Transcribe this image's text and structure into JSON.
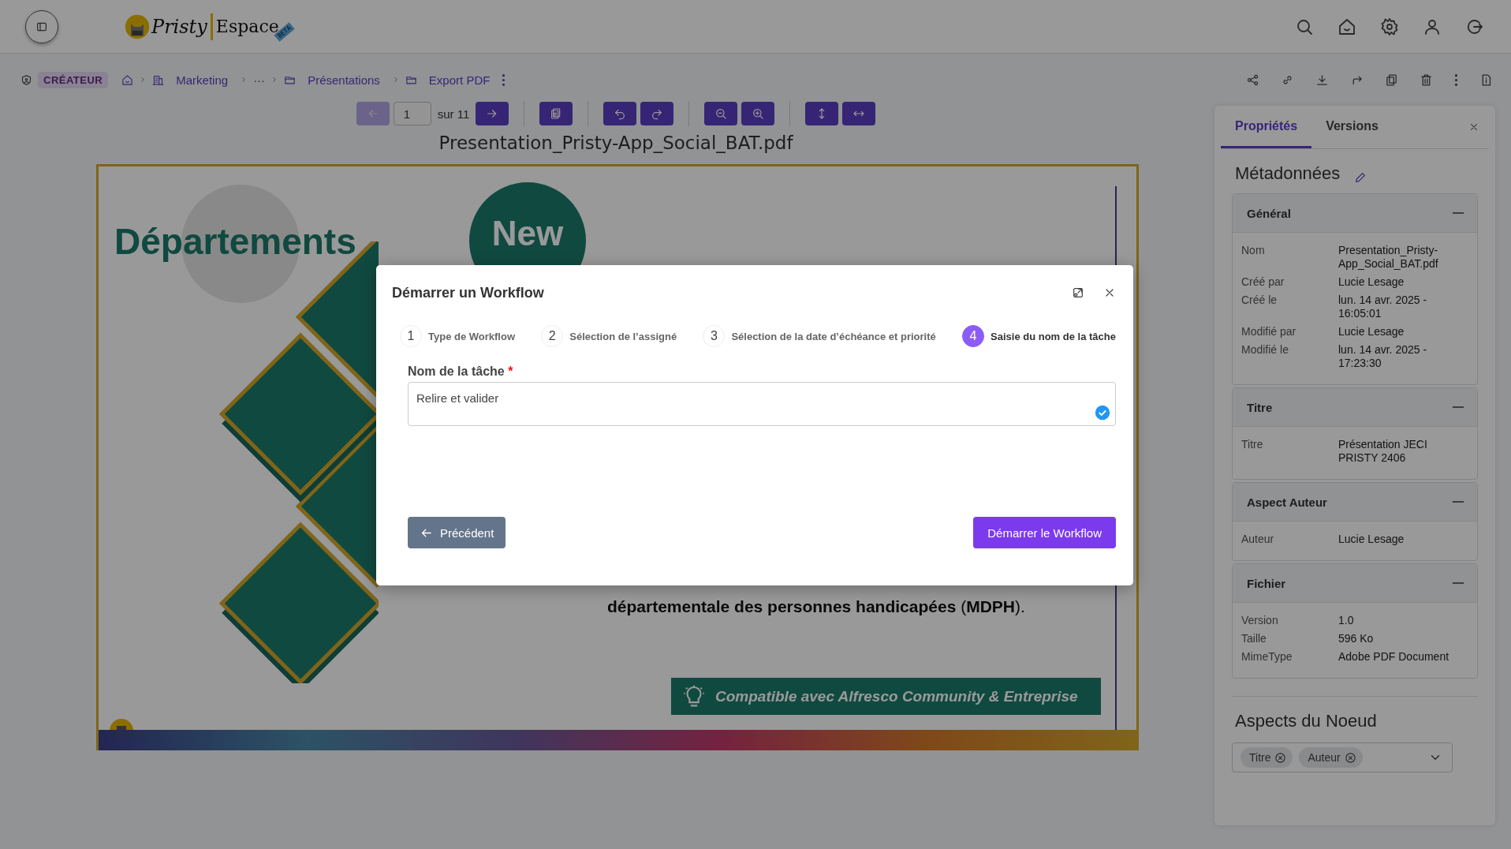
{
  "header": {
    "logo": {
      "name": "Pristy",
      "product": "Espace",
      "badge": "BETA"
    }
  },
  "breadcrumb": {
    "role": "CRÉATEUR",
    "items": [
      "Marketing",
      "···",
      "Présentations",
      "Export PDF"
    ]
  },
  "viewer": {
    "prev_enabled": false,
    "page": "1",
    "page_total": "sur 11",
    "filename": "Presentation_Pristy-App_Social_BAT.pdf",
    "slide": {
      "title": "Départements",
      "badge": "New",
      "text": "**départementale des personnes handicapées** (**MDPH**).",
      "banner": "Compatible avec Alfresco Community & Entreprise"
    }
  },
  "side_panel": {
    "tabs": [
      {
        "label": "Propriétés",
        "selected": true
      },
      {
        "label": "Versions",
        "selected": false
      }
    ],
    "heading": "Métadonnées",
    "sections": [
      {
        "title": "Général",
        "expanded": true,
        "rows": [
          {
            "label": "Nom",
            "value": "Presentation_Pristy-App_Social_BAT.pdf"
          },
          {
            "label": "Créé par",
            "value": "Lucie Lesage"
          },
          {
            "label": "Créé le",
            "value": "lun. 14 avr. 2025 - 16:05:01"
          },
          {
            "label": "Modifié par",
            "value": "Lucie Lesage"
          },
          {
            "label": "Modifié le",
            "value": "lun. 14 avr. 2025 - 17:23:30"
          }
        ]
      },
      {
        "title": "Titre",
        "expanded": true,
        "rows": [
          {
            "label": "Titre",
            "value": "Présentation JECI PRISTY 2406"
          }
        ]
      },
      {
        "title": "Aspect Auteur",
        "expanded": true,
        "rows": [
          {
            "label": "Auteur",
            "value": "Lucie Lesage"
          }
        ]
      },
      {
        "title": "Fichier",
        "expanded": true,
        "rows": [
          {
            "label": "Version",
            "value": "1.0"
          },
          {
            "label": "Taille",
            "value": "596 Ko"
          },
          {
            "label": "MimeType",
            "value": "Adobe PDF Document"
          }
        ]
      }
    ],
    "aspects": {
      "heading": "Aspects du Noeud",
      "tags": [
        "Titre",
        "Auteur"
      ]
    }
  },
  "modal": {
    "title": "Démarrer un Workflow",
    "steps": [
      {
        "number": "1",
        "label": "Type de Workflow",
        "selected": false
      },
      {
        "number": "2",
        "label": "Sélection de l’assigné",
        "selected": false
      },
      {
        "number": "3",
        "label": "Sélection de la date d’échéance et priorité",
        "selected": false
      },
      {
        "number": "4",
        "label": "Saisie du nom de la tâche",
        "selected": true
      }
    ],
    "field": {
      "label": "Nom de la tâche",
      "required_mark": "*",
      "value": "Relire et valider",
      "valid": true
    },
    "back_button": "Précédent",
    "submit_button": "Démarrer le Workflow"
  }
}
